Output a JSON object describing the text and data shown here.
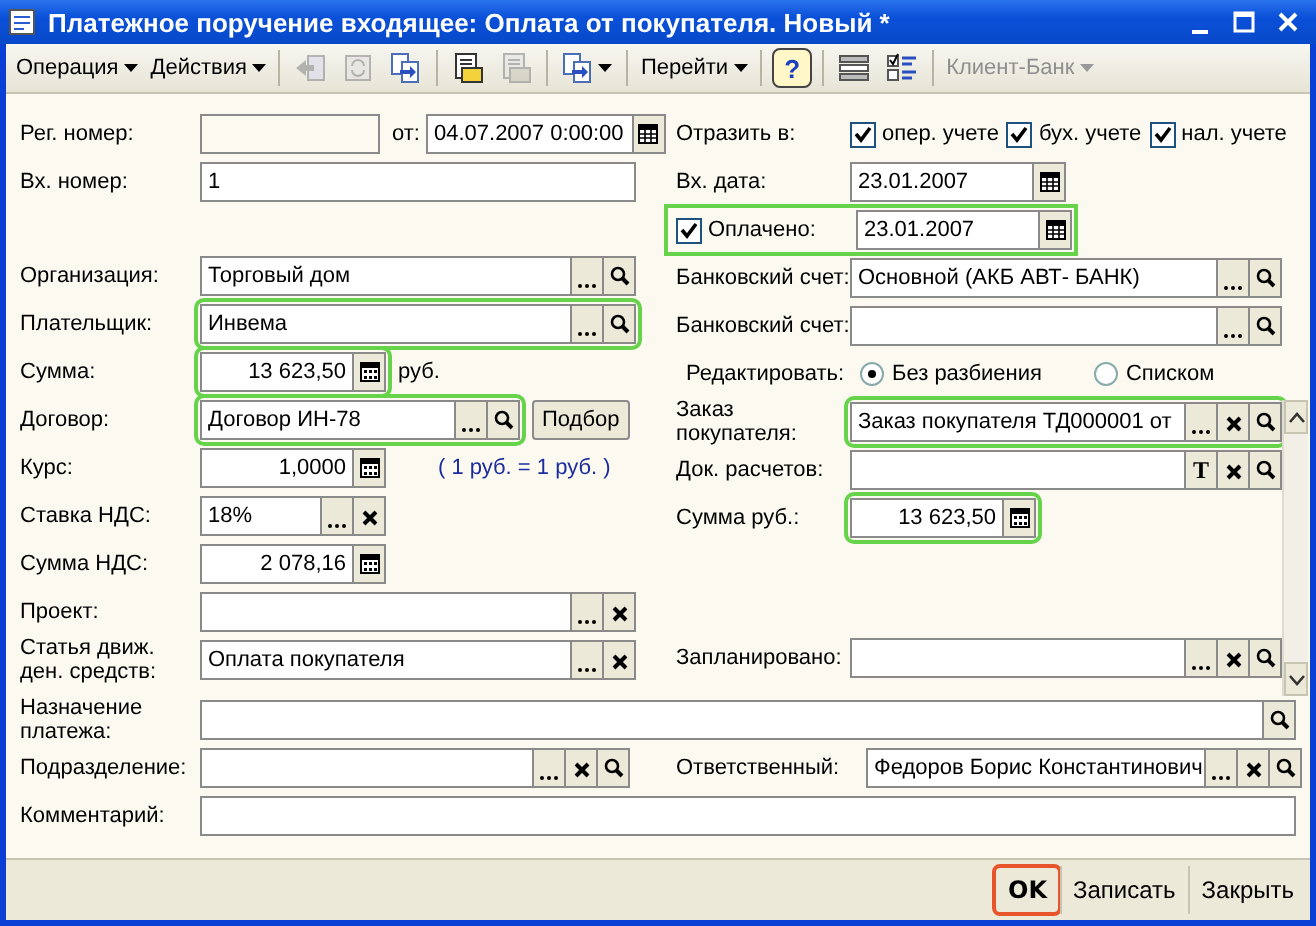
{
  "window": {
    "title": "Платежное поручение входящее: Оплата от покупателя. Новый *"
  },
  "toolbar": [
    {
      "kind": "menu",
      "label": "Операция",
      "disabled": false
    },
    {
      "kind": "menu",
      "label": "Действия",
      "disabled": false
    },
    {
      "kind": "sep"
    },
    {
      "kind": "arrow",
      "disabled": true
    },
    {
      "kind": "refresh",
      "disabled": true
    },
    {
      "kind": "copy",
      "disabled": false
    },
    {
      "kind": "sep"
    },
    {
      "kind": "document",
      "disabled": false
    },
    {
      "kind": "document",
      "disabled": true
    },
    {
      "kind": "sep"
    },
    {
      "kind": "copydrop",
      "disabled": false
    },
    {
      "kind": "sep"
    },
    {
      "kind": "menu",
      "label": "Перейти",
      "disabled": false
    },
    {
      "kind": "sep"
    },
    {
      "kind": "help",
      "text": "?"
    },
    {
      "kind": "sep"
    },
    {
      "kind": "list"
    },
    {
      "kind": "checklist"
    },
    {
      "kind": "sep"
    },
    {
      "kind": "menu",
      "label": "Клиент-Банк",
      "disabled": true
    }
  ],
  "left": [
    {
      "kind": "regnum",
      "label": "Рег. номер:",
      "date_label": "от:",
      "date": "04.07.2007  0:00:00"
    },
    {
      "kind": "text",
      "label": "Вх. номер:",
      "value": "1",
      "highlighted": false
    },
    {
      "kind": "gap"
    },
    {
      "kind": "reference",
      "label": "Организация:",
      "value": "Торговый дом",
      "buttons": [
        {
          "kind": "choose"
        },
        {
          "kind": "search"
        }
      ],
      "highlighted": false
    },
    {
      "kind": "reference",
      "label": "Плательщик:",
      "value": "Инвема",
      "buttons": [
        {
          "kind": "choose"
        },
        {
          "kind": "search"
        }
      ],
      "highlighted": true
    },
    {
      "kind": "number",
      "label": "Сумма:",
      "value": "13 623,50",
      "buttons": [
        {
          "kind": "calculator"
        }
      ],
      "highlighted": true,
      "suffix": "руб."
    },
    {
      "kind": "reference",
      "label": "Договор:",
      "value": "Договор ИН-78",
      "buttons": [
        {
          "kind": "choose"
        },
        {
          "kind": "search"
        }
      ],
      "highlighted": true,
      "extra_button": "Подбор"
    },
    {
      "kind": "number",
      "label": "Курс:",
      "value": "1,0000",
      "buttons": [
        {
          "kind": "calculator"
        }
      ],
      "highlighted": false,
      "note": "( 1 руб. = 1 руб. )"
    },
    {
      "kind": "enum",
      "label": "Ставка НДС:",
      "value": "18%",
      "buttons": [
        {
          "kind": "choose"
        },
        {
          "kind": "clear"
        }
      ],
      "highlighted": false
    },
    {
      "kind": "number",
      "label": "Сумма НДС:",
      "value": "2 078,16",
      "buttons": [
        {
          "kind": "calculator"
        }
      ],
      "highlighted": false
    },
    {
      "kind": "reference",
      "label": "Проект:",
      "buttons": [
        {
          "kind": "choose"
        },
        {
          "kind": "clear"
        }
      ],
      "highlighted": false
    },
    {
      "kind": "reference",
      "label": "Статья движ. ден. средств:",
      "value": "Оплата покупателя",
      "buttons": [
        {
          "kind": "choose"
        },
        {
          "kind": "clear"
        }
      ],
      "highlighted": false
    }
  ],
  "right": [
    {
      "kind": "checks",
      "label": "Отразить в:",
      "options": [
        {
          "label": "опер. учете",
          "checked": true
        },
        {
          "label": "бух. учете",
          "checked": true
        },
        {
          "label": "нал. учете",
          "checked": true
        }
      ]
    },
    {
      "kind": "date",
      "label": "Вх. дата:",
      "value": "23.01.2007",
      "buttons": [
        {
          "kind": "calendar"
        }
      ],
      "highlighted": false
    },
    {
      "kind": "checkfield",
      "label": "Оплачено:",
      "checked": true,
      "value": "23.01.2007",
      "buttons": [
        {
          "kind": "calendar"
        }
      ],
      "highlighted": true
    },
    {
      "kind": "reference",
      "label": "Банковский счет:",
      "value": "Основной  (АКБ АВТ- БАНК)",
      "buttons": [
        {
          "kind": "choose"
        },
        {
          "kind": "search"
        }
      ],
      "highlighted": false
    },
    {
      "kind": "reference",
      "label": "Банковский счет:",
      "buttons": [
        {
          "kind": "choose"
        },
        {
          "kind": "search"
        }
      ],
      "highlighted": false
    },
    {
      "kind": "radio",
      "label": "Редактировать:",
      "options": [
        {
          "label": "Без разбиения",
          "selected": true
        },
        {
          "label": "Списком",
          "selected": false
        }
      ]
    }
  ],
  "right_scrolled": [
    {
      "kind": "reference",
      "label": "Заказ покупателя:",
      "value": "Заказ покупателя ТД000001 от",
      "buttons": [
        {
          "kind": "choose"
        },
        {
          "kind": "clear"
        },
        {
          "kind": "search"
        }
      ],
      "highlighted": true
    },
    {
      "kind": "reference",
      "label": "Док. расчетов:",
      "buttons": [
        {
          "kind": "type",
          "text": "T"
        },
        {
          "kind": "clear"
        },
        {
          "kind": "search"
        }
      ],
      "highlighted": false
    },
    {
      "kind": "number",
      "label": "Сумма руб.:",
      "value": "13 623,50",
      "buttons": [
        {
          "kind": "calculator"
        }
      ],
      "highlighted": true
    },
    {
      "kind": "gap"
    },
    {
      "kind": "gap"
    },
    {
      "kind": "reference",
      "label": "Запланировано:",
      "buttons": [
        {
          "kind": "choose"
        },
        {
          "kind": "clear"
        },
        {
          "kind": "search"
        }
      ],
      "highlighted": false
    }
  ],
  "bottom": [
    {
      "kind": "reference",
      "label": "Назначение платежа:",
      "buttons": [
        {
          "kind": "search"
        }
      ],
      "highlighted": false
    },
    {
      "kind": "pair",
      "items": [
        {
          "kind": "reference",
          "label": "Подразделение:",
          "buttons": [
            {
              "kind": "choose"
            },
            {
              "kind": "clear"
            },
            {
              "kind": "search"
            }
          ],
          "highlighted": false
        },
        {
          "kind": "reference",
          "label": "Ответственный:",
          "value": "Федоров Борис Константинович",
          "buttons": [
            {
              "kind": "choose"
            },
            {
              "kind": "clear"
            },
            {
              "kind": "search"
            }
          ],
          "highlighted": false
        }
      ]
    },
    {
      "kind": "text",
      "label": "Комментарий:",
      "highlighted": false
    }
  ],
  "footer": [
    {
      "label": "OK",
      "default": true,
      "highlighted": true
    },
    {
      "label": "Записать",
      "default": false,
      "highlighted": false
    },
    {
      "label": "Закрыть",
      "default": false,
      "highlighted": false
    }
  ]
}
